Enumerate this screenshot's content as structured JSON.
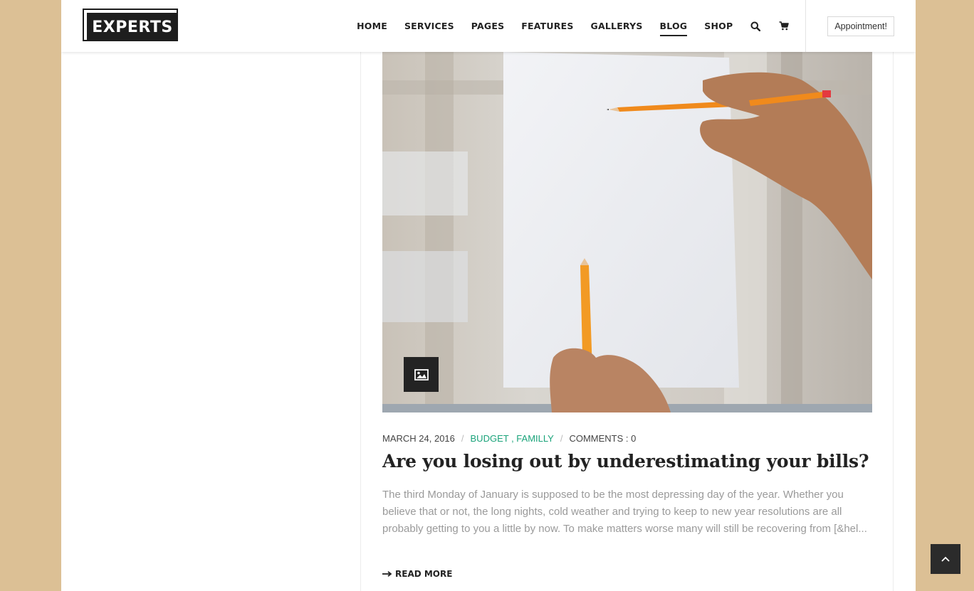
{
  "header": {
    "logo_text": "EXPERTS",
    "nav": [
      {
        "label": "HOME"
      },
      {
        "label": "SERVICES"
      },
      {
        "label": "PAGES"
      },
      {
        "label": "FEATURES"
      },
      {
        "label": "GALLERYS"
      },
      {
        "label": "BLOG",
        "active": true
      },
      {
        "label": "SHOP"
      }
    ],
    "icons": [
      "search-icon",
      "cart-icon"
    ],
    "appointment_label": "Appointment!"
  },
  "post": {
    "image_icon": "image-icon",
    "date": "MARCH 24, 2016",
    "categories": [
      "BUDGET",
      "FAMILLY"
    ],
    "category_joiner": " , ",
    "comments": "COMMENTS : 0",
    "meta_separator": "/",
    "title": "Are you losing out by underestimating your bills?",
    "excerpt": "The third Monday of January is supposed to be the most depressing day of the year. Whether you believe that or not, the long nights, cold weather and trying to keep to new year resolutions are all probably getting to you a little by now. To make matters worse many will still be recovering from [&hel...",
    "read_more": "READ MORE"
  },
  "colors": {
    "page_background": "#dcc095",
    "accent_category": "#1aa37a",
    "text_dark": "#222222",
    "text_muted": "#9a9a9a"
  },
  "back_to_top_icon": "chevron-up-icon"
}
